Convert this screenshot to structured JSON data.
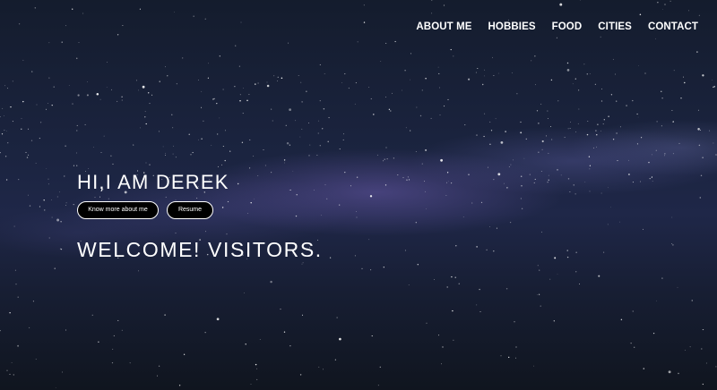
{
  "nav": {
    "items": [
      {
        "label": "ABOUT ME"
      },
      {
        "label": "HOBBIES"
      },
      {
        "label": "FOOD"
      },
      {
        "label": "CITIES"
      },
      {
        "label": "CONTACT"
      }
    ]
  },
  "hero": {
    "greeting": "HI,I AM DEREK",
    "about_button": "Know more about me",
    "resume_button": "Resume",
    "welcome": "WELCOME! VISITORS."
  },
  "colors": {
    "text": "#ffffff",
    "button_background": "#000000",
    "sky_dark": "#141c2d",
    "milky_way": "#7864be"
  }
}
